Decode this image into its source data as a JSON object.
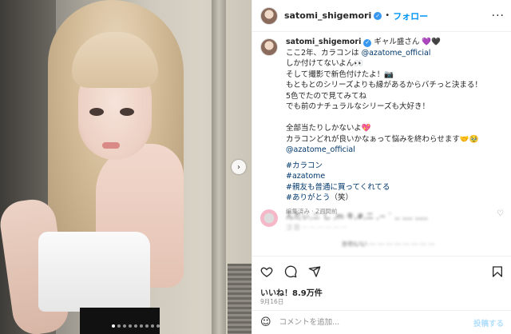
{
  "header": {
    "username": "satomi_shigemori",
    "separator": "•",
    "follow_label": "フォロー",
    "more_label": "···"
  },
  "caption": {
    "username": "satomi_shigemori",
    "lines": [
      " ギャル盛さん 💜🖤",
      "ここ2年、カラコンは ",
      "しか付けてないよん👀",
      "そして撮影で新色付けたよ！📷",
      "もともとのシリーズよりも縁があるからバチっと決まる！",
      "5色でたので見てみてね",
      "でも前のナチュラルなシリーズも大好き！",
      "",
      "全部当たりしかないよ💖",
      "カラコンどれが良いかなぁって悩みを終わらせます🤝🥹"
    ],
    "mention1": "@azatome_official",
    "mention2": "@azatome_official",
    "hashtags": [
      "#カラコン",
      "#azatome",
      "#親友も普通に買ってくれてる",
      "#ありがとう"
    ],
    "last_tag_suffix": "（笑）",
    "meta": "編集済み · 2週間前"
  },
  "comments": {
    "blurred_1": "んたぃ,ニ し ,m キ,#,ニ ,~ ` ,, ,,,, ,,,,,",
    "blurred_1_meta": "ゴ 日 ⋯ ⋯ ⋯ ⋯ ⋯ ⋯",
    "blurred_2": "かわいい ⋯ ⋯ ⋯ ⋯ ⋯ ⋯ ⋯ ⋯"
  },
  "actions": {
    "like_icon": "heart-icon",
    "comment_icon": "comment-icon",
    "share_icon": "share-icon",
    "save_icon": "bookmark-icon"
  },
  "likes": "いいね！8.9万件",
  "date": "9月16日",
  "composer": {
    "placeholder": "コメントを追加...",
    "post_label": "投稿する"
  },
  "carousel": {
    "next_icon": "chevron-right-icon",
    "dot_count": 9,
    "active_index": 0
  },
  "colors": {
    "accent": "#0095f6",
    "link": "#00376b",
    "muted": "#8e8e8e"
  }
}
